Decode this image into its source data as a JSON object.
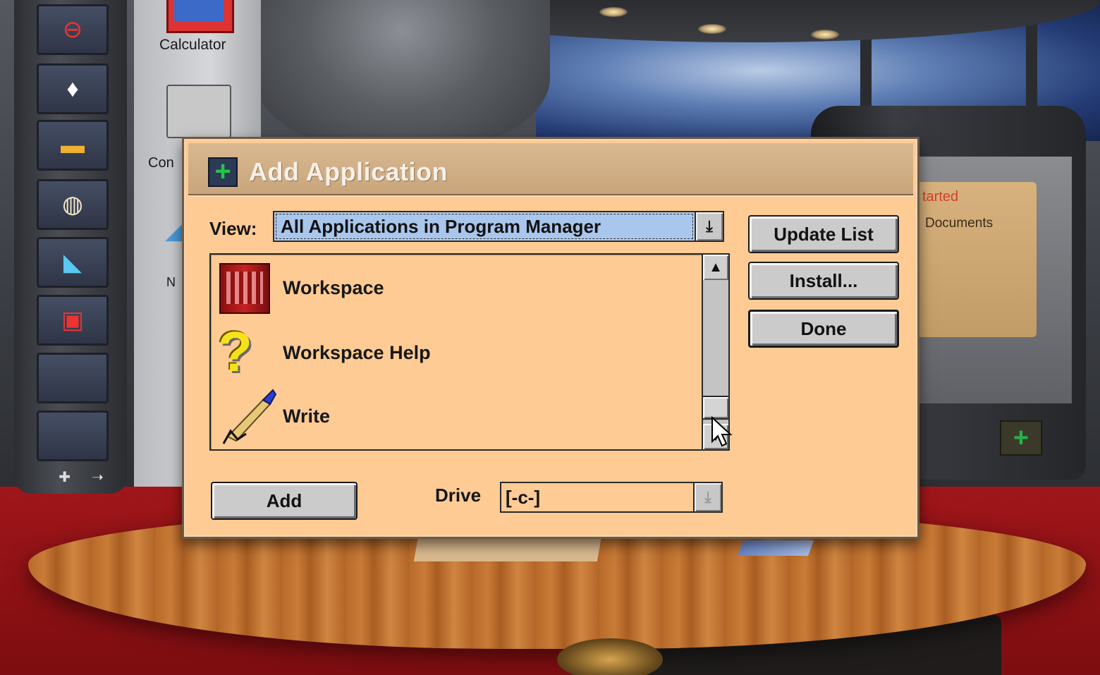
{
  "background": {
    "calculator_label": "Calculator",
    "control_label_partial": "Con",
    "n_label_partial": "N",
    "folder_title_partial": "tarted",
    "folder_label": "Documents"
  },
  "dialog": {
    "title": "Add Application",
    "view_label": "View:",
    "view_value": "All Applications in Program Manager",
    "list_items": [
      {
        "label": "Workspace",
        "icon": "workspace-icon"
      },
      {
        "label": "Workspace Help",
        "icon": "help-icon"
      },
      {
        "label": "Write",
        "icon": "write-icon"
      }
    ],
    "buttons": {
      "update_list": "Update List",
      "install": "Install...",
      "done": "Done",
      "add": "Add"
    },
    "drive_label": "Drive",
    "drive_value": "[-c-]"
  },
  "colors": {
    "dialog_bg": "#fecb94",
    "titlebar": "#c9a57b",
    "selection": "#a9c6ec",
    "button": "#cbcbcb"
  }
}
